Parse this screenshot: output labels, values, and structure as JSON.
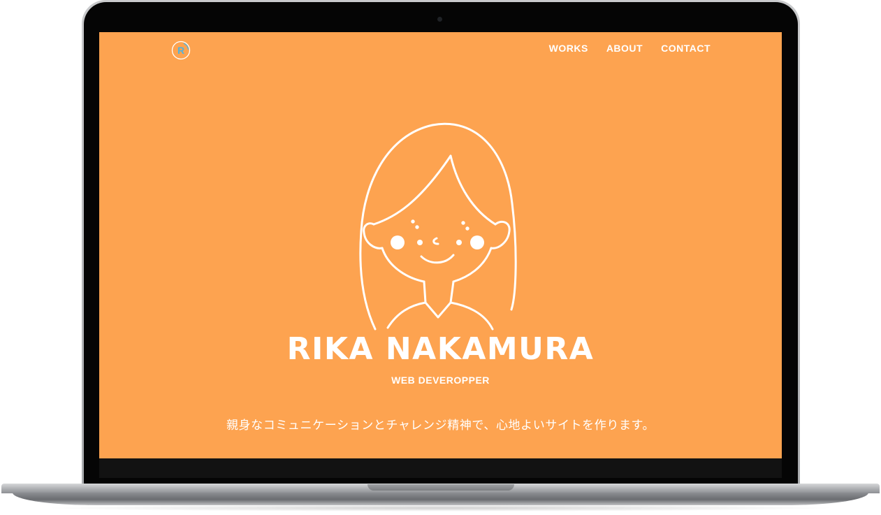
{
  "site": {
    "logo_letter": "R",
    "nav": [
      {
        "label": "WORKS"
      },
      {
        "label": "ABOUT"
      },
      {
        "label": "CONTACT"
      }
    ]
  },
  "hero": {
    "name": "RIKA NAKAMURA",
    "role": "WEB DEVEROPPER",
    "tagline": "親身なコミュニケーションとチャレンジ精神で、心地よいサイトを作ります。"
  },
  "colors": {
    "background": "#fda350",
    "text": "#ffffff",
    "logo_accent": "#4fb3e0"
  },
  "icons": {
    "logo": "r-circle-logo",
    "avatar": "girl-face-line-illustration"
  }
}
